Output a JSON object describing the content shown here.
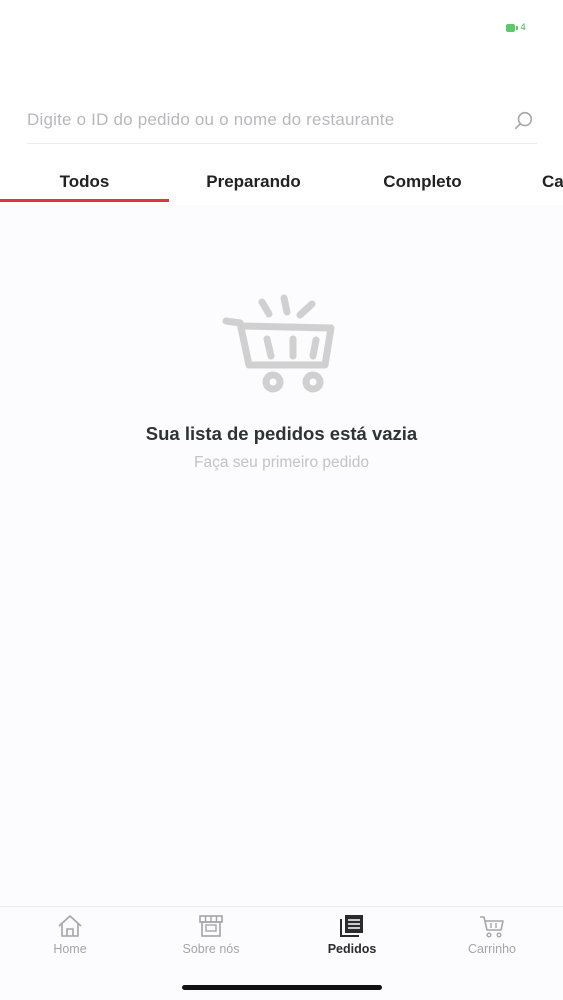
{
  "status_bar": {
    "battery_level": "4",
    "battery_color": "#5cc96a"
  },
  "search": {
    "placeholder": "Digite o ID do pedido ou o nome do restaurante",
    "value": ""
  },
  "tabs": [
    {
      "label": "Todos",
      "active": true
    },
    {
      "label": "Preparando",
      "active": false
    },
    {
      "label": "Completo",
      "active": false
    },
    {
      "label": "Ca",
      "active": false
    }
  ],
  "empty_state": {
    "icon": "shopping-cart-icon",
    "title": "Sua lista de pedidos está vazia",
    "subtitle": "Faça seu primeiro pedido"
  },
  "bottom_nav": [
    {
      "label": "Home",
      "icon": "home-icon",
      "active": false
    },
    {
      "label": "Sobre nós",
      "icon": "store-icon",
      "active": false
    },
    {
      "label": "Pedidos",
      "icon": "orders-icon",
      "active": true
    },
    {
      "label": "Carrinho",
      "icon": "cart-icon",
      "active": false
    }
  ],
  "colors": {
    "accent": "#e0353b",
    "muted_text": "#c3c3c8",
    "icon_gray": "#cfcfcf"
  }
}
